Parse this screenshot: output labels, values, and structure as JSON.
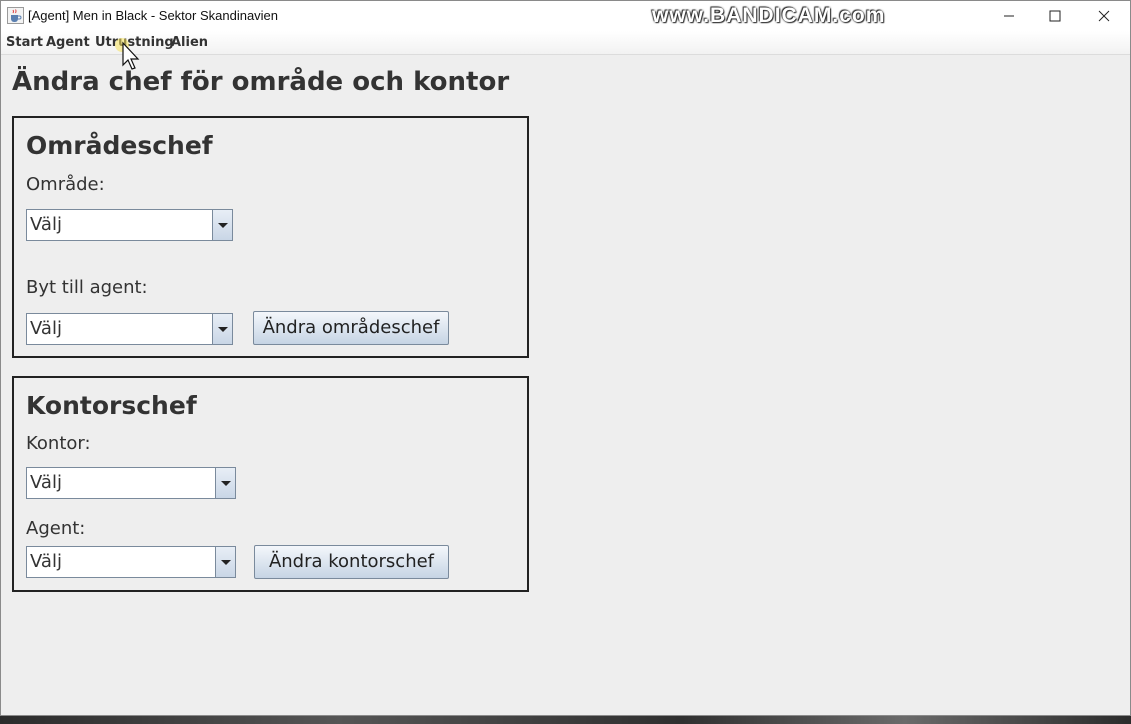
{
  "window": {
    "title": "[Agent] Men in Black - Sektor Skandinavien",
    "watermark": "www.BANDICAM.com"
  },
  "menu": {
    "items": [
      "Start",
      "Agent",
      "Utrustning",
      "Alien"
    ]
  },
  "page": {
    "title": "Ändra chef för område och kontor"
  },
  "area_panel": {
    "title": "Områdeschef",
    "area_label": "Område:",
    "area_value": "Välj",
    "agent_label": "Byt till agent:",
    "agent_value": "Välj",
    "button_label": "Ändra områdeschef"
  },
  "office_panel": {
    "title": "Kontorschef",
    "office_label": "Kontor:",
    "office_value": "Välj",
    "agent_label": "Agent:",
    "agent_value": "Välj",
    "button_label": "Ändra kontorschef"
  },
  "colors": {
    "window_bg": "#eeeeee",
    "text": "#333333",
    "panel_border": "#222222",
    "button_gradient_top": "#f4f7fb",
    "button_gradient_bottom": "#c6d4e4"
  },
  "icons": {
    "app": "java-coffee-icon",
    "minimize": "minimize-icon",
    "maximize": "maximize-icon",
    "close": "close-icon",
    "dropdown": "chevron-down-icon",
    "cursor": "mouse-pointer-icon"
  }
}
